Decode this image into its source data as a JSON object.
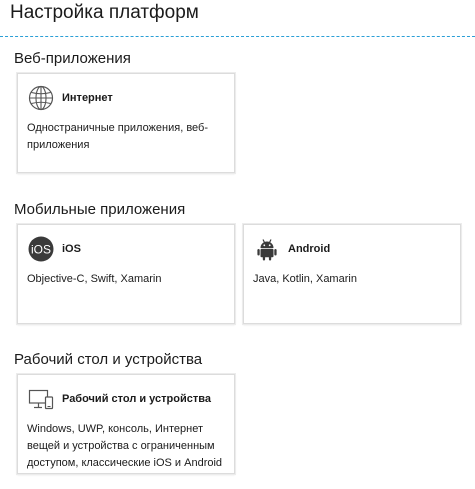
{
  "page": {
    "title": "Настройка платформ"
  },
  "sections": [
    {
      "heading": "Веб-приложения",
      "cards": [
        {
          "icon": "globe-icon",
          "title": "Интернет",
          "description": "Одностраничные приложения, веб-приложения"
        }
      ]
    },
    {
      "heading": "Мобильные приложения",
      "cards": [
        {
          "icon": "ios-icon",
          "icon_text": "iOS",
          "title": "iOS",
          "description": "Objective-C, Swift, Xamarin"
        },
        {
          "icon": "android-icon",
          "title": "Android",
          "description": "Java, Kotlin, Xamarin"
        }
      ]
    },
    {
      "heading": "Рабочий стол и устройства",
      "cards": [
        {
          "icon": "desktop-device-icon",
          "title": "Рабочий стол и устройства",
          "description": "Windows, UWP, консоль, Интернет вещей и устройства с ограниченным доступом, классические iOS и Android"
        }
      ]
    }
  ],
  "colors": {
    "divider": "#2b9fd6",
    "card_border": "#dcdcdc",
    "icon_dark": "#3a3a3a",
    "text": "#1b1b1b"
  }
}
